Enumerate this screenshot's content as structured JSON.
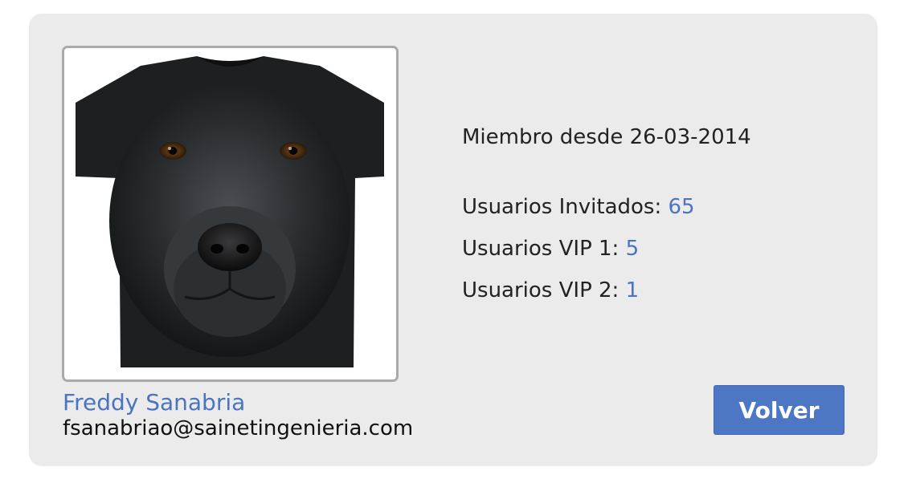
{
  "profile": {
    "member_since_label": "Miembro desde",
    "member_since_date": "26-03-2014",
    "invited_label": "Usuarios Invitados:",
    "invited_count": "65",
    "vip1_label": "Usuarios VIP 1:",
    "vip1_count": "5",
    "vip2_label": "Usuarios VIP 2:",
    "vip2_count": "1",
    "name": "Freddy Sanabria",
    "email": "fsanabriao@sainetingenieria.com",
    "photo_subject": "black-dog-tshirt"
  },
  "actions": {
    "back_label": "Volver"
  },
  "colors": {
    "accent": "#4a73c2",
    "button": "#4d76c4",
    "card_background": "#ebebeb"
  }
}
